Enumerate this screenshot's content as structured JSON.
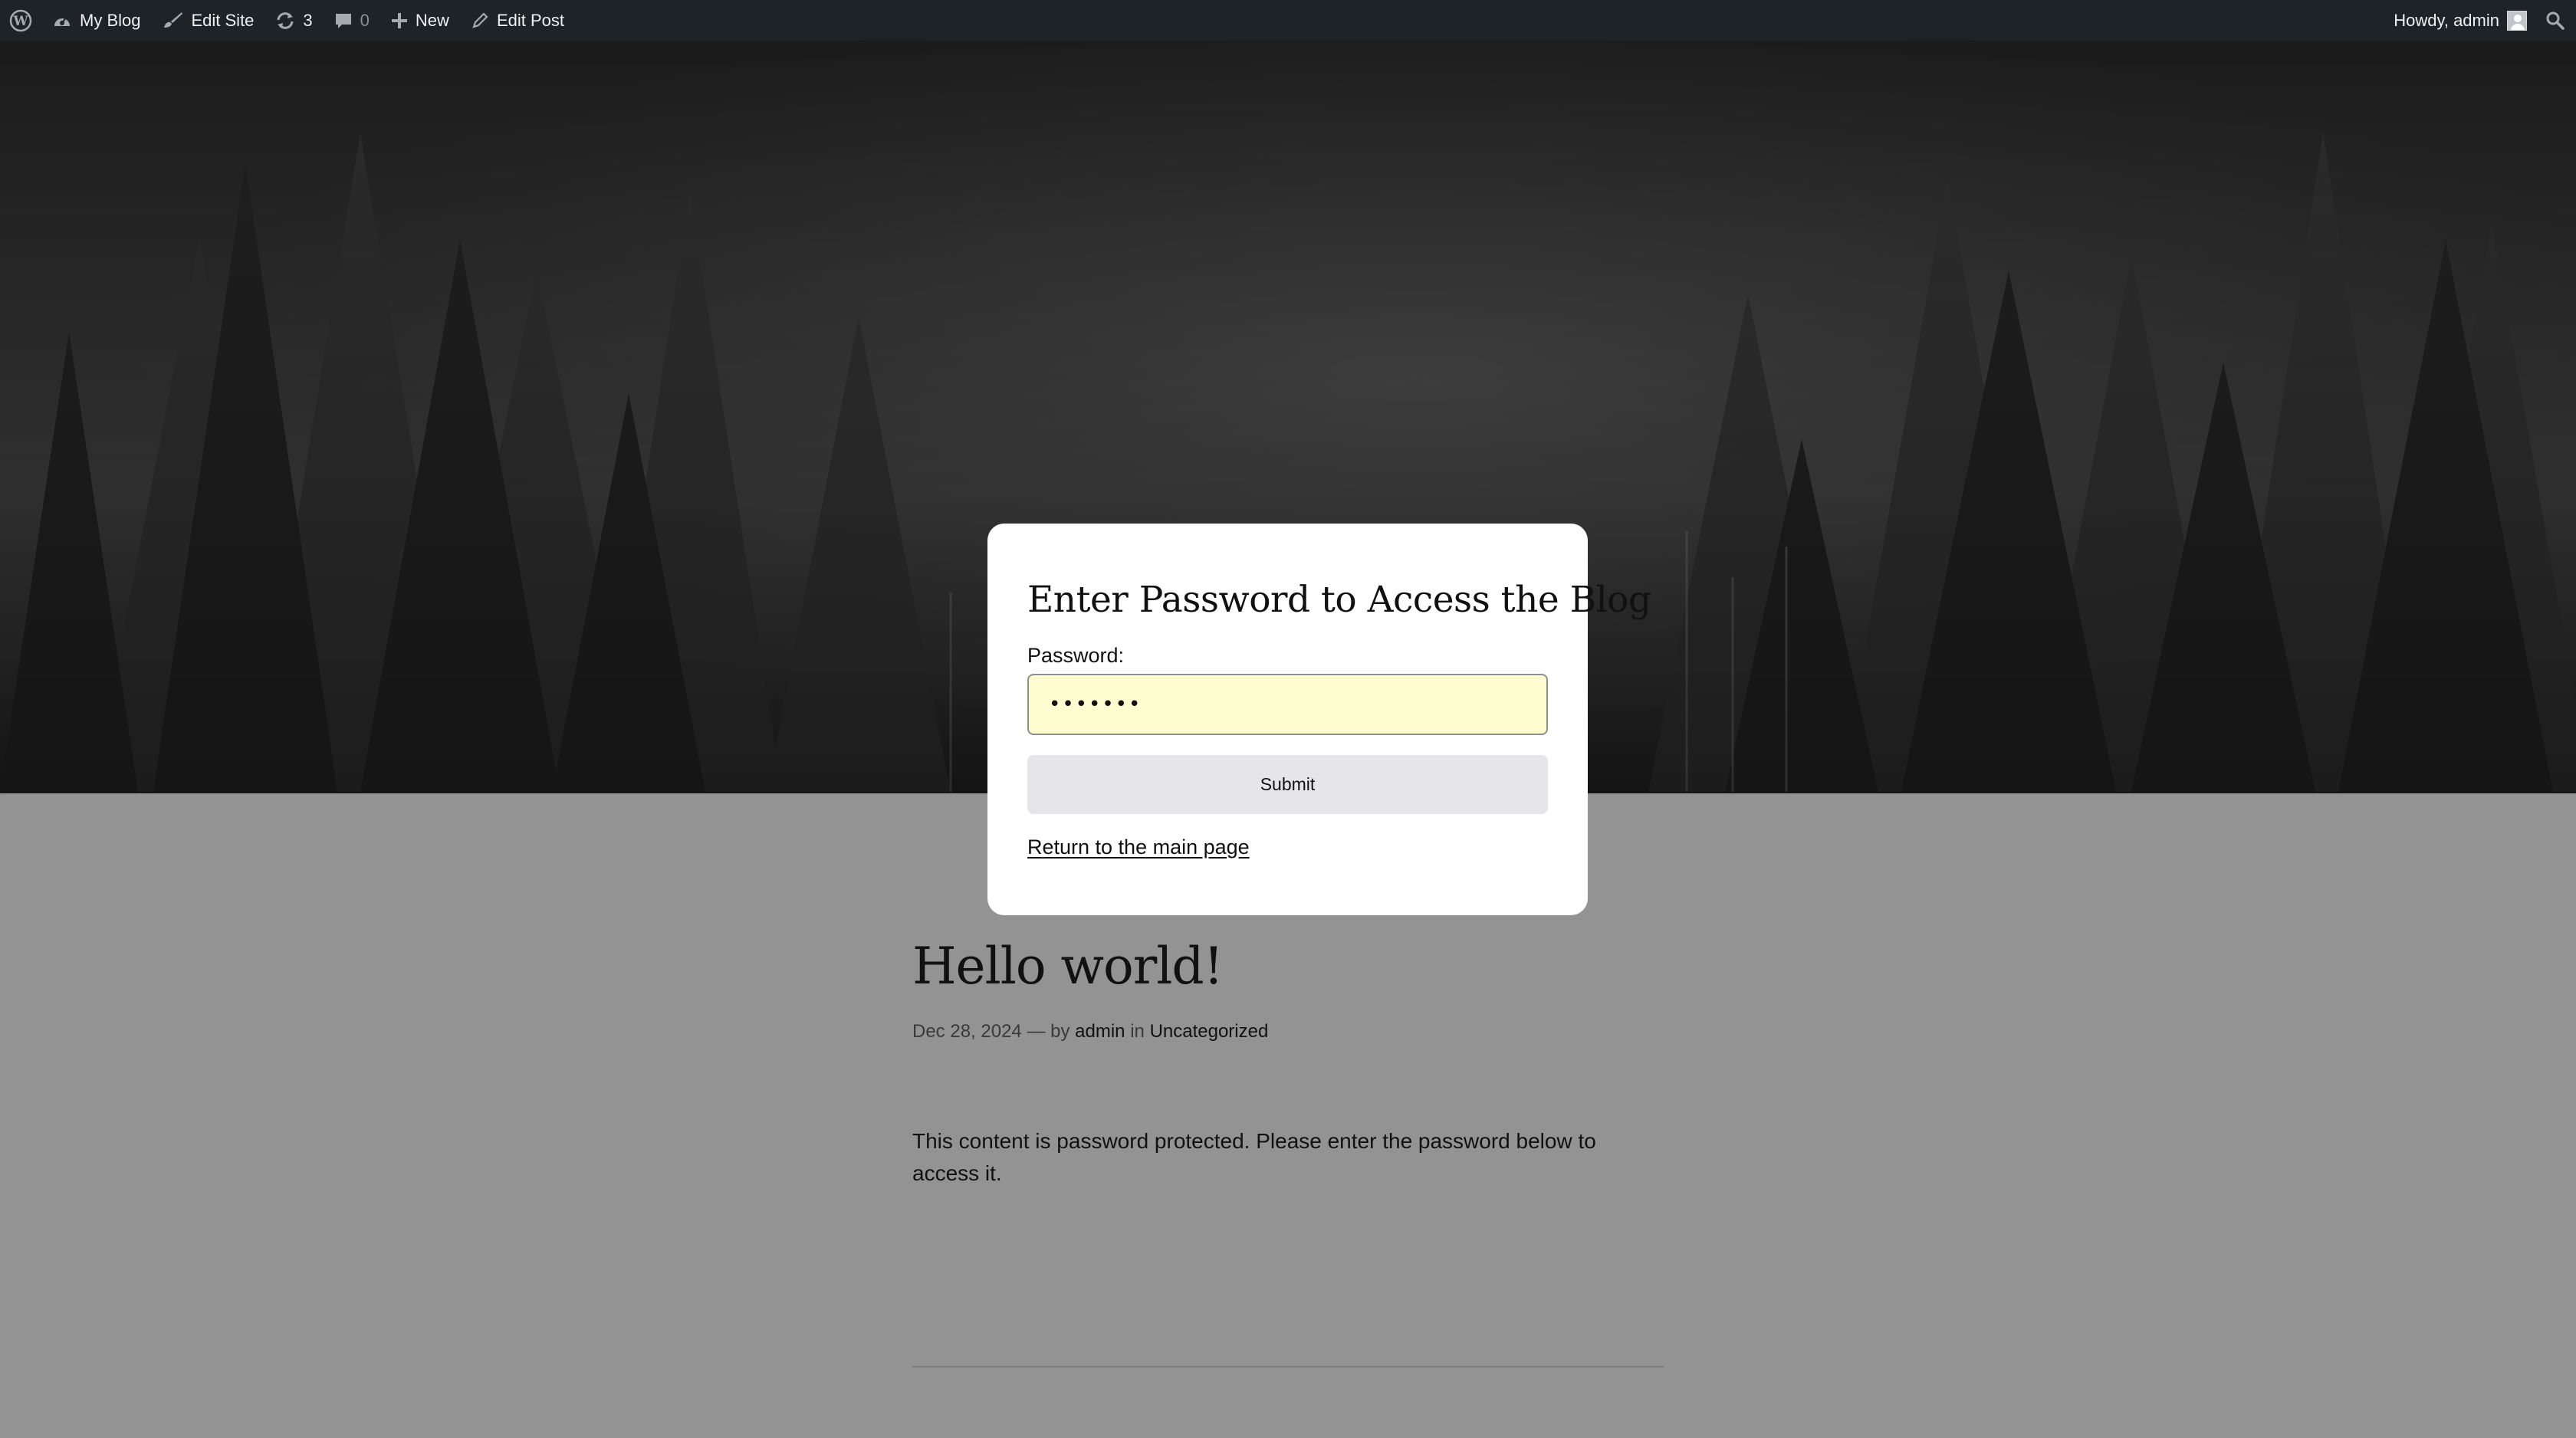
{
  "adminbar": {
    "site_name": "My Blog",
    "edit_site": "Edit Site",
    "updates_count": "3",
    "comments_count": "0",
    "new_label": "New",
    "edit_post": "Edit Post",
    "howdy": "Howdy, admin",
    "icons": [
      "wordpress-logo-icon",
      "dashboard-gauge-icon",
      "brush-icon",
      "refresh-icon",
      "comment-icon",
      "plus-icon",
      "pencil-icon",
      "avatar-icon",
      "search-icon"
    ],
    "colors": {
      "bar": "#1d2327",
      "text": "#f0f0f1",
      "muted": "#8c8f94"
    }
  },
  "modal": {
    "title": "Enter Password to Access the Blog",
    "password_label": "Password:",
    "password_value": "•••••••",
    "submit_label": "Submit",
    "return_link": "Return to the main page",
    "colors": {
      "input_bg": "#fefdd0",
      "button_bg": "#e6e6ea"
    }
  },
  "post": {
    "title": "Hello world!",
    "date": "Dec 28, 2024",
    "dash": "—",
    "by": "by",
    "author": "admin",
    "in": "in",
    "category": "Uncategorized",
    "body": "This content is password protected. Please enter the password below to access it."
  }
}
